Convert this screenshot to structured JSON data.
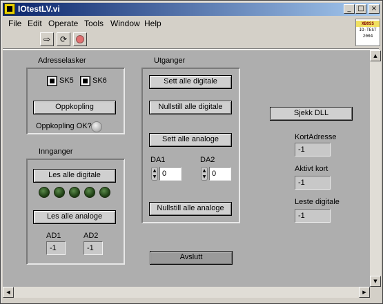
{
  "window": {
    "title": "IOtestLV.vi",
    "minimize": "_",
    "maximize": "□",
    "close": "×"
  },
  "menu": [
    "File",
    "Edit",
    "Operate",
    "Tools",
    "Window",
    "Help"
  ],
  "logo": {
    "line1": "XBOSS",
    "line2": "IO-TEST",
    "line3": "2004"
  },
  "adresselasker": {
    "title": "Adresselasker",
    "sk5": "SK5",
    "sk6": "SK6",
    "oppkopling_button": "Oppkopling",
    "oppkopling_ok_label": "Oppkopling OK?"
  },
  "innganger": {
    "title": "Innganger",
    "les_digitale_button": "Les alle digitale",
    "les_analoge_button": "Les alle analoge",
    "ad1_label": "AD1",
    "ad1_value": "-1",
    "ad2_label": "AD2",
    "ad2_value": "-1"
  },
  "utganger": {
    "title": "Utganger",
    "sett_digitale_button": "Sett alle digitale",
    "nullstill_digitale_button": "Nullstill alle digitale",
    "sett_analoge_button": "Sett alle analoge",
    "da1_label": "DA1",
    "da1_value": "0",
    "da2_label": "DA2",
    "da2_value": "0",
    "nullstill_analoge_button": "Nullstill alle analoge"
  },
  "sjekk_dll_button": "Sjekk DLL",
  "kortadresse": {
    "label": "KortAdresse",
    "value": "-1"
  },
  "aktivt_kort": {
    "label": "Aktivt kort",
    "value": "-1"
  },
  "leste_digitale": {
    "label": "Leste digitale",
    "value": "-1"
  },
  "avslutt_button": "Avslutt"
}
